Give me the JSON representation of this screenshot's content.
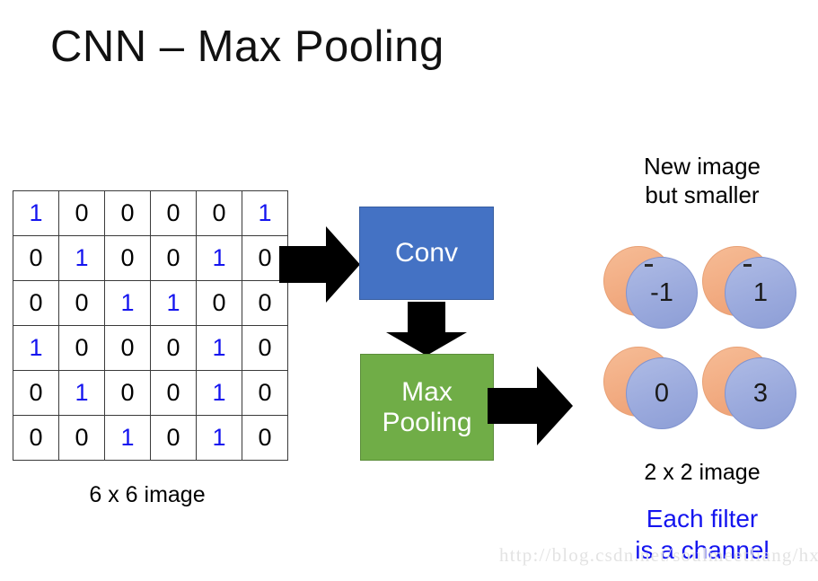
{
  "title": "CNN – Max Pooling",
  "input": {
    "caption": "6 x 6 image",
    "matrix": [
      [
        "1",
        "0",
        "0",
        "0",
        "0",
        "1"
      ],
      [
        "0",
        "1",
        "0",
        "0",
        "1",
        "0"
      ],
      [
        "0",
        "0",
        "1",
        "1",
        "0",
        "0"
      ],
      [
        "1",
        "0",
        "0",
        "0",
        "1",
        "0"
      ],
      [
        "0",
        "1",
        "0",
        "0",
        "1",
        "0"
      ],
      [
        "0",
        "0",
        "1",
        "0",
        "1",
        "0"
      ]
    ],
    "highlight_value": "1",
    "highlight_color": "#1515ef",
    "cell_color": "#000000"
  },
  "pipeline": {
    "conv": {
      "label": "Conv",
      "color": "#4472C4"
    },
    "maxpool": {
      "label_line1": "Max",
      "label_line2": "Pooling",
      "color": "#70AD47"
    },
    "arrows": [
      {
        "name": "input-to-conv",
        "direction": "right"
      },
      {
        "name": "conv-to-maxpool",
        "direction": "down"
      },
      {
        "name": "maxpool-to-output",
        "direction": "right"
      }
    ],
    "arrow_color": "#000000"
  },
  "output": {
    "heading_line1": "New image",
    "heading_line2": "but smaller",
    "caption": "2 x 2 image",
    "note_line1": "Each filter",
    "note_line2": "is a channel",
    "note_color": "#1515ef",
    "back_circle_color": "#F2AC82",
    "front_circle_color": "#9BAADD",
    "values": [
      [
        "-1",
        "1"
      ],
      [
        "0",
        "3"
      ]
    ]
  },
  "watermark": {
    "text": "http://blog.csdn.net/soulmeetliang/hxin"
  }
}
